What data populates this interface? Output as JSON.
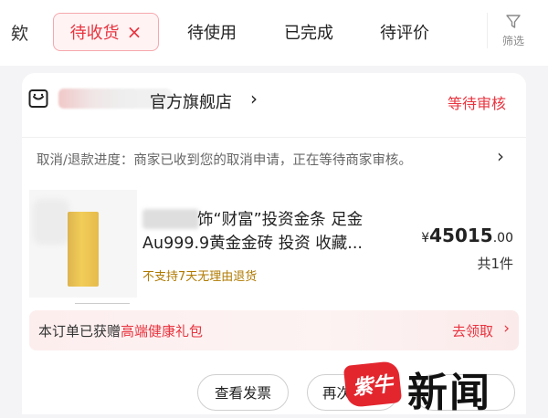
{
  "tabs": {
    "partial_label": "欸",
    "active_label": "待收货",
    "close_symbol": "×",
    "items": [
      "待使用",
      "已完成",
      "待评价"
    ],
    "filter_label": "筛选"
  },
  "order": {
    "shop_name": "官方旗舰店",
    "shop_arrow": "›",
    "status": "等待审核",
    "refund_progress": "取消/退款进度：商家已收到您的取消申请，正在等待商家审核。",
    "refund_arrow": "›",
    "product_title_line1": "饰“财富”投资金条 足金",
    "product_title_line2": "Au999.9黄金金砖 投资 收藏...",
    "no_return": "不支持7天无理由退货",
    "price_currency": "¥",
    "price_integer": "45015",
    "price_decimal": ".00",
    "quantity": "共1件",
    "gift_prefix": "本订单已获赠",
    "gift_highlight": "高端健康礼包",
    "gift_link": "去领取",
    "gift_arrow": "›",
    "buttons": {
      "invoice": "查看发票",
      "rebuy": "再次"
    }
  },
  "watermark": {
    "logo_text": "紫牛",
    "text": "新闻"
  },
  "colors": {
    "accent": "#e8343f",
    "gold": "#f2cd58",
    "warning": "#b07a00"
  },
  "icons": [
    "close-icon",
    "filter-icon",
    "shop-icon",
    "chevron-right-icon"
  ]
}
